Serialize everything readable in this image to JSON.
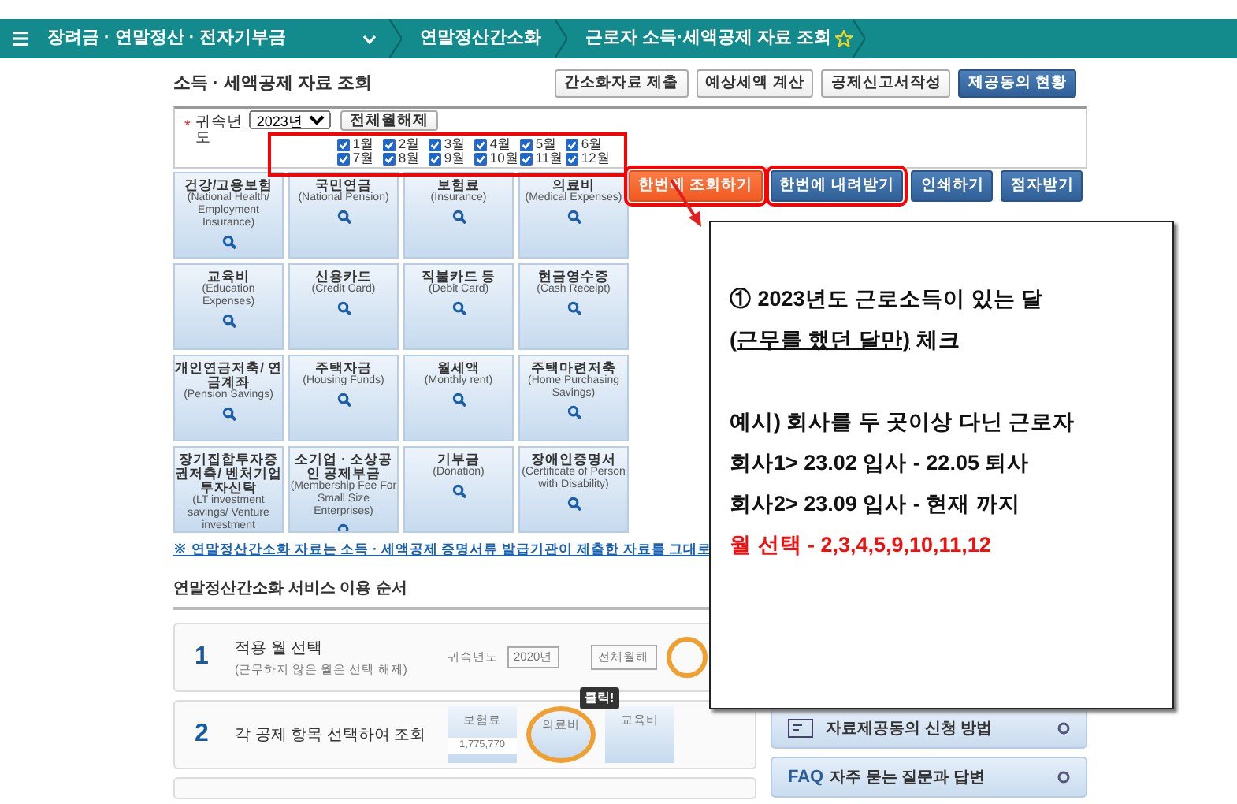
{
  "topbar": {
    "menu_label": "장려금 · 연말정산 · 전자기부금",
    "crumbs": [
      {
        "label": "연말정산간소화",
        "favorite": false
      },
      {
        "label": "근로자 소득·세액공제 자료 조회",
        "favorite": true
      }
    ]
  },
  "page_title": "소득 · 세액공제 자료 조회",
  "header_buttons": [
    {
      "label": "간소화자료 제출",
      "kind": "plain"
    },
    {
      "label": "예상세액 계산",
      "kind": "plain"
    },
    {
      "label": "공제신고서작성",
      "kind": "plain"
    },
    {
      "label": "제공동의 현황",
      "kind": "primary"
    }
  ],
  "filter": {
    "required_mark": "*",
    "label": "귀속년도",
    "year": "2023년",
    "toggle_button": "전체월해제",
    "months_highlighted": true,
    "months": [
      {
        "label": "1월",
        "checked": true
      },
      {
        "label": "2월",
        "checked": true
      },
      {
        "label": "3월",
        "checked": true
      },
      {
        "label": "4월",
        "checked": true
      },
      {
        "label": "5월",
        "checked": true
      },
      {
        "label": "6월",
        "checked": true
      },
      {
        "label": "7월",
        "checked": true
      },
      {
        "label": "8월",
        "checked": true
      },
      {
        "label": "9월",
        "checked": true
      },
      {
        "label": "10월",
        "checked": true
      },
      {
        "label": "11월",
        "checked": true
      },
      {
        "label": "12월",
        "checked": true
      }
    ]
  },
  "action_buttons": [
    {
      "label": "한번에 조회하기",
      "kind": "orange",
      "highlighted": true
    },
    {
      "label": "한번에 내려받기",
      "kind": "primary",
      "highlighted": true
    },
    {
      "label": "인쇄하기",
      "kind": "primary",
      "highlighted": false
    },
    {
      "label": "점자받기",
      "kind": "primary",
      "highlighted": false
    }
  ],
  "tiles": [
    {
      "title": "건강/고용보험",
      "subtitle": "(National Health/ Employment Insurance)",
      "search_icon": true
    },
    {
      "title": "국민연금",
      "subtitle": "(National Pension)",
      "search_icon": true
    },
    {
      "title": "보험료",
      "subtitle": "(Insurance)",
      "search_icon": true
    },
    {
      "title": "의료비",
      "subtitle": "(Medical Expenses)",
      "search_icon": true
    },
    {
      "title": "교육비",
      "subtitle": "(Education Expenses)",
      "search_icon": true
    },
    {
      "title": "신용카드",
      "subtitle": "(Credit Card)",
      "search_icon": true
    },
    {
      "title": "직불카드 등",
      "subtitle": "(Debit Card)",
      "search_icon": true
    },
    {
      "title": "현금영수증",
      "subtitle": "(Cash Receipt)",
      "search_icon": true
    },
    {
      "title": "개인연금저축/ 연금계좌",
      "subtitle": "(Pension Savings)",
      "search_icon": true
    },
    {
      "title": "주택자금",
      "subtitle": "(Housing Funds)",
      "search_icon": true
    },
    {
      "title": "월세액",
      "subtitle": "(Monthly rent)",
      "search_icon": true
    },
    {
      "title": "주택마련저축",
      "subtitle": "(Home Purchasing Savings)",
      "search_icon": true
    },
    {
      "title": "장기집합투자증권저축/ 벤처기업투자신탁",
      "subtitle": "(LT investment savings/ Venture investment",
      "search_icon": false
    },
    {
      "title": "소기업 · 소상공인 공제부금",
      "subtitle": "(Membership Fee For Small Size Enterprises)",
      "search_icon": true
    },
    {
      "title": "기부금",
      "subtitle": "(Donation)",
      "search_icon": true
    },
    {
      "title": "장애인증명서",
      "subtitle": "(Certificate of Person with Disability)",
      "search_icon": true
    }
  ],
  "notice": "※ 연말정산간소화 자료는 소득 · 세액공제 증명서류 발급기관이 제출한 자료를 그대로",
  "steps_heading": "연말정산간소화 서비스 이용 순서",
  "steps": [
    {
      "number": "1",
      "title": "적용 월 선택",
      "subtitle": "(근무하지 않은 월은 선택 해제)",
      "kind": "months",
      "preview": {
        "label": "귀속년도",
        "year": "2020년",
        "button": "전체월해"
      }
    },
    {
      "number": "2",
      "title": "각 공제 항목 선택하여 조회",
      "kind": "tiles",
      "preview": {
        "tiles": [
          "보험료",
          "의료비",
          "교육비"
        ],
        "amount": "1,775,770",
        "tip": "클릭!"
      }
    },
    {
      "kind": "partial"
    }
  ],
  "side_links": [
    {
      "label": "자료제공동의 신청 방법",
      "kind": "doc"
    },
    {
      "label": "자주 묻는 질문과 답변",
      "badge": "FAQ",
      "kind": "faq"
    }
  ],
  "callout": {
    "lines": [
      {
        "text": "① 2023년도 근로소득이 있는 달",
        "kind": "normal"
      },
      {
        "text": "(근무를 했던 달만)",
        "suffix": " 체크",
        "kind": "underlined"
      },
      {
        "kind": "blank"
      },
      {
        "text": "예시) 회사를 두 곳이상 다닌 근로자",
        "kind": "normal"
      },
      {
        "text": "회사1> 23.02 입사 - 22.05 퇴사",
        "kind": "normal"
      },
      {
        "text": "회사2> 23.09 입사 - 현재 까지",
        "kind": "normal"
      },
      {
        "text": "월 선택 - 2,3,4,5,9,10,11,12",
        "kind": "red"
      }
    ]
  }
}
